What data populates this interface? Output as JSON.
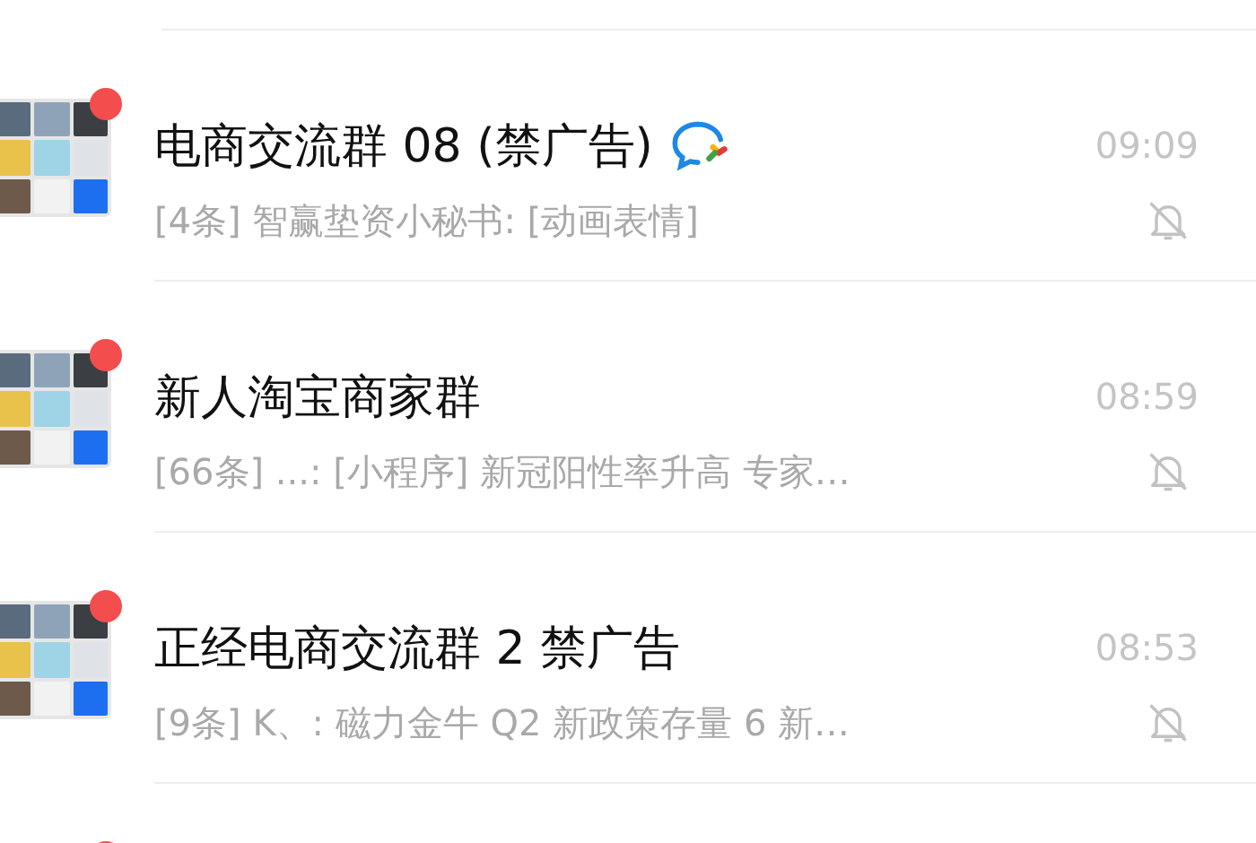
{
  "chats": [
    {
      "title": "电商交流群 08 (禁广告)",
      "enterprise_tag": true,
      "preview": "[4条] 智赢垫资小秘书: [动画表情]",
      "time": "09:09",
      "unread": true,
      "muted": true
    },
    {
      "title": "新人淘宝商家群",
      "enterprise_tag": false,
      "preview": "[66条] ...: [小程序] 新冠阳性率升高 专家…",
      "time": "08:59",
      "unread": true,
      "muted": true
    },
    {
      "title": "正经电商交流群 2 禁广告",
      "enterprise_tag": false,
      "preview": "[9条] K、: 磁力金牛 Q2 新政策存量 6 新…",
      "time": "08:53",
      "unread": true,
      "muted": true
    },
    {
      "unread": true
    }
  ]
}
